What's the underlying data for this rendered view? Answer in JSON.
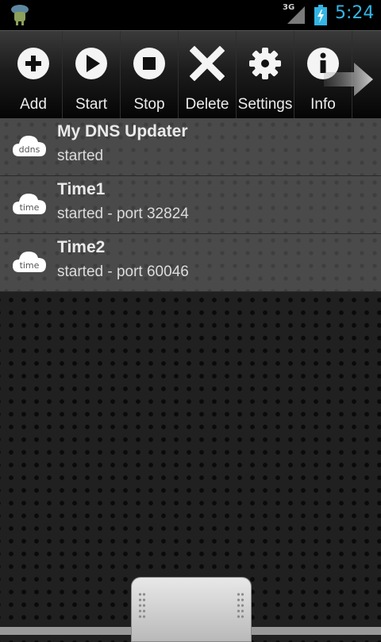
{
  "status_bar": {
    "network_label": "3G",
    "time": "5:24"
  },
  "toolbar": {
    "add_label": "Add",
    "start_label": "Start",
    "stop_label": "Stop",
    "delete_label": "Delete",
    "settings_label": "Settings",
    "info_label": "Info"
  },
  "services": [
    {
      "icon": "ddns",
      "title": "My DNS Updater",
      "status": "started"
    },
    {
      "icon": "time",
      "title": "Time1",
      "status": "started - port 32824"
    },
    {
      "icon": "time",
      "title": "Time2",
      "status": "started - port 60046"
    }
  ],
  "colors": {
    "accent": "#33b5e5",
    "row_bg": "#4a4a4a",
    "background": "#202020"
  }
}
